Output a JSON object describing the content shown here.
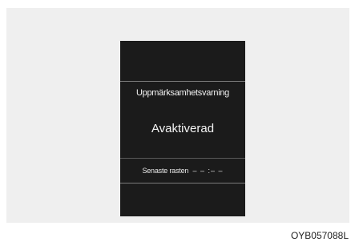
{
  "display": {
    "warning_title": "Uppmärksamhetsvarning",
    "status": "Avaktiverad",
    "last_break_label": "Senaste rasten",
    "last_break_value": "– – :– –"
  },
  "caption": "OYB057088L",
  "colors": {
    "display_background": "#1b1b1b",
    "frame_background": "#efefef",
    "text": "#f2f2f2"
  }
}
